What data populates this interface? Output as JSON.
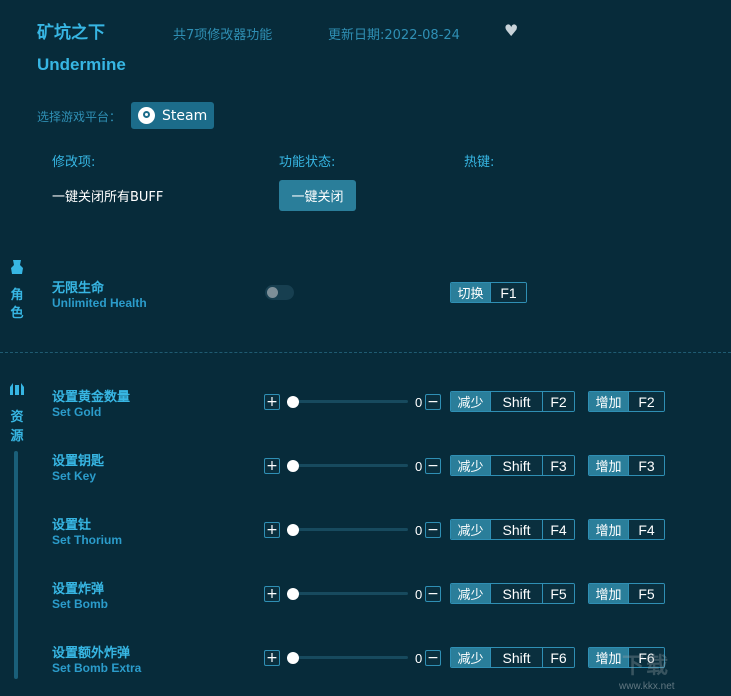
{
  "header": {
    "title_cn": "矿坑之下",
    "title_en": "Undermine",
    "feature_count": "共7项修改器功能",
    "update_date": "更新日期:2022-08-24",
    "favorite_icon": "heart-icon"
  },
  "platform": {
    "label": "选择游戏平台：",
    "steam_label": "Steam"
  },
  "columns": {
    "mod": "修改项:",
    "status": "功能状态:",
    "hotkey": "热键:"
  },
  "buff": {
    "label": "一键关闭所有BUFF",
    "button": "一键关闭"
  },
  "categories": {
    "role": {
      "line1": "角",
      "line2": "色",
      "icon": "character-icon"
    },
    "resource": {
      "line1": "资",
      "line2": "源",
      "icon": "resource-icon"
    }
  },
  "health": {
    "name_cn": "无限生命",
    "name_en": "Unlimited Health",
    "toggle_label": "切换",
    "key": "F1",
    "enabled": false
  },
  "sliders": [
    {
      "name_cn": "设置黄金数量",
      "name_en": "Set Gold",
      "value": "0",
      "dec_label": "减少",
      "dec_mod": "Shift",
      "dec_key": "F2",
      "inc_label": "增加",
      "inc_key": "F2"
    },
    {
      "name_cn": "设置钥匙",
      "name_en": "Set Key",
      "value": "0",
      "dec_label": "减少",
      "dec_mod": "Shift",
      "dec_key": "F3",
      "inc_label": "增加",
      "inc_key": "F3"
    },
    {
      "name_cn": "设置钍",
      "name_en": "Set Thorium",
      "value": "0",
      "dec_label": "减少",
      "dec_mod": "Shift",
      "dec_key": "F4",
      "inc_label": "增加",
      "inc_key": "F4"
    },
    {
      "name_cn": "设置炸弹",
      "name_en": "Set Bomb",
      "value": "0",
      "dec_label": "减少",
      "dec_mod": "Shift",
      "dec_key": "F5",
      "inc_label": "增加",
      "inc_key": "F5"
    },
    {
      "name_cn": "设置额外炸弹",
      "name_en": "Set Bomb Extra",
      "value": "0",
      "dec_label": "减少",
      "dec_mod": "Shift",
      "dec_key": "F6",
      "inc_label": "增加",
      "inc_key": "F6"
    }
  ],
  "watermark": {
    "text": "下载",
    "url": "www.kkx.net"
  },
  "colors": {
    "background": "#072b3a",
    "accent": "#37b6e3",
    "button": "#2a7e9a"
  }
}
